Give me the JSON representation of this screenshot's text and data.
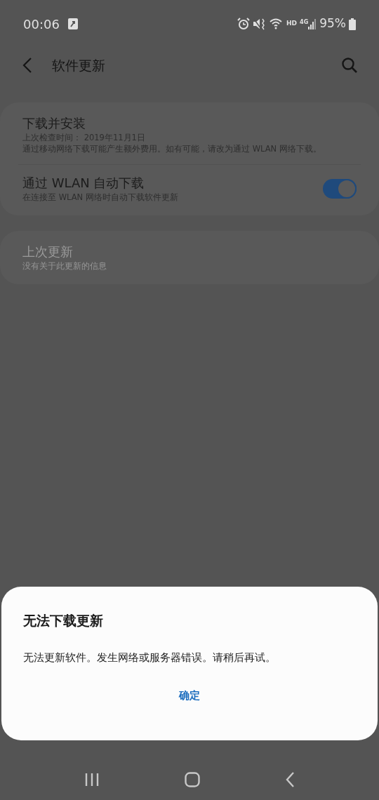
{
  "status_bar": {
    "time": "00:06",
    "hd": "HD",
    "network": "4G",
    "battery": "95%"
  },
  "header": {
    "title": "软件更新"
  },
  "sections": [
    {
      "items": [
        {
          "kind": "info",
          "title": "下载并安装",
          "lines": [
            "上次检查时间： 2019年11月1日",
            "通过移动网络下载可能产生额外费用。如有可能，请改为通过 WLAN 网络下载。"
          ],
          "disabled": false
        },
        {
          "kind": "toggle",
          "title": "通过 WLAN 自动下载",
          "lines": [
            "在连接至 WLAN 网络时自动下载软件更新"
          ],
          "on": true,
          "disabled": false
        }
      ]
    },
    {
      "items": [
        {
          "kind": "info",
          "title": "上次更新",
          "lines": [
            "没有关于此更新的信息"
          ],
          "disabled": true
        }
      ]
    }
  ],
  "dialog": {
    "title": "无法下载更新",
    "message": "无法更新软件。发生网络或服务器错误。请稍后再试。",
    "button": "确定"
  }
}
